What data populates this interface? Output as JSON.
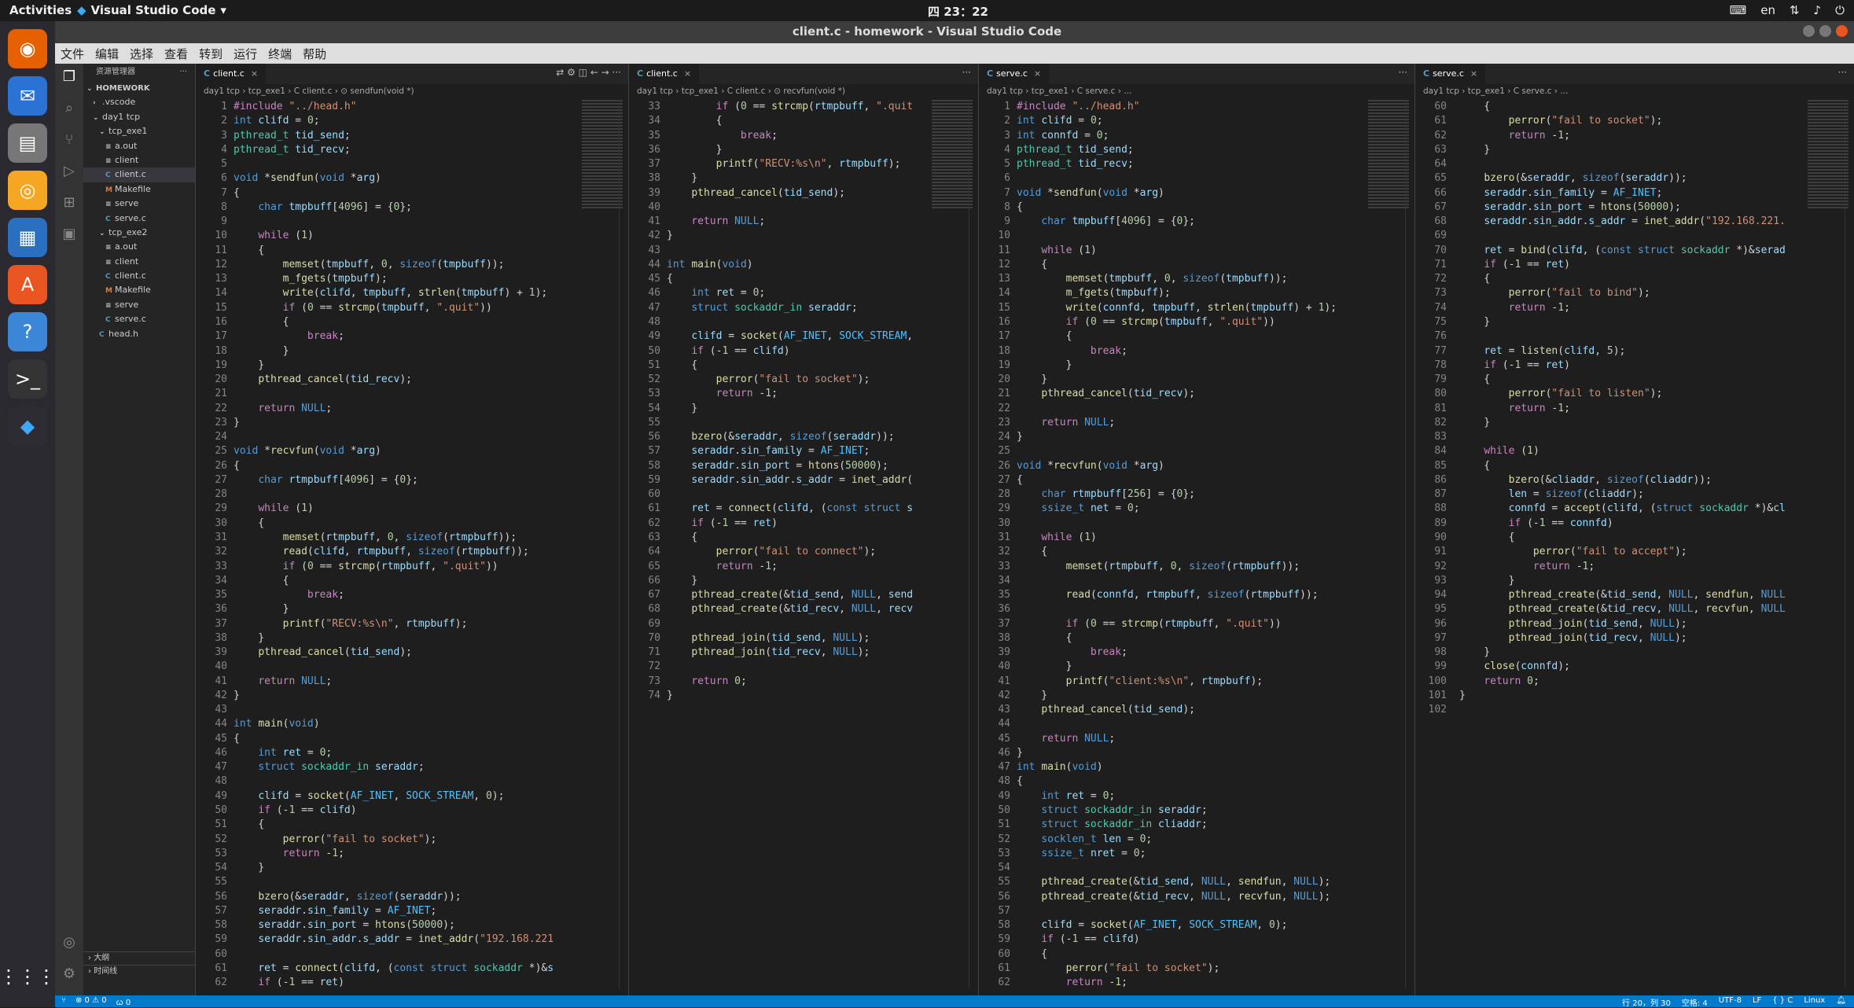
{
  "topbar": {
    "activities": "Activities",
    "app_name": "Visual Studio Code",
    "clock": "四 23：22",
    "lang": "en"
  },
  "window": {
    "title": "client.c - homework - Visual Studio Code"
  },
  "menu": [
    "文件",
    "编辑",
    "选择",
    "查看",
    "转到",
    "运行",
    "终端",
    "帮助"
  ],
  "sidebar": {
    "title": "资源管理器",
    "tree": [
      {
        "label": "HOMEWORK",
        "depth": 0,
        "icon": "chevron-down-icon"
      },
      {
        "label": ".vscode",
        "depth": 1,
        "icon": "chevron-right-icon"
      },
      {
        "label": "day1 tcp",
        "depth": 1,
        "icon": "chevron-down-icon"
      },
      {
        "label": "tcp_exe1",
        "depth": 2,
        "icon": "chevron-down-icon"
      },
      {
        "label": "a.out",
        "depth": 3,
        "icon": "binary-file-icon"
      },
      {
        "label": "client",
        "depth": 3,
        "icon": "binary-file-icon"
      },
      {
        "label": "client.c",
        "depth": 3,
        "icon": "c-file-icon",
        "selected": true
      },
      {
        "label": "Makefile",
        "depth": 3,
        "icon": "makefile-icon"
      },
      {
        "label": "serve",
        "depth": 3,
        "icon": "binary-file-icon"
      },
      {
        "label": "serve.c",
        "depth": 3,
        "icon": "c-file-icon"
      },
      {
        "label": "tcp_exe2",
        "depth": 2,
        "icon": "chevron-down-icon"
      },
      {
        "label": "a.out",
        "depth": 3,
        "icon": "binary-file-icon"
      },
      {
        "label": "client",
        "depth": 3,
        "icon": "binary-file-icon"
      },
      {
        "label": "client.c",
        "depth": 3,
        "icon": "c-file-icon"
      },
      {
        "label": "Makefile",
        "depth": 3,
        "icon": "makefile-icon"
      },
      {
        "label": "serve",
        "depth": 3,
        "icon": "binary-file-icon"
      },
      {
        "label": "serve.c",
        "depth": 3,
        "icon": "c-file-icon"
      },
      {
        "label": "head.h",
        "depth": 2,
        "icon": "c-file-icon"
      }
    ],
    "outline": "大纲",
    "timeline": "时间线"
  },
  "panes": [
    {
      "tab": "client.c",
      "breadcrumb": "day1 tcp › tcp_exe1 › C client.c › ⊙ sendfun(void *)",
      "start": 1,
      "lines": [
        "#include \"../head.h\"",
        "int clifd = 0;",
        "pthread_t tid_send;",
        "pthread_t tid_recv;",
        "",
        "void *sendfun(void *arg)",
        "{",
        "    char tmpbuff[4096] = {0};",
        "",
        "    while (1)",
        "    {",
        "        memset(tmpbuff, 0, sizeof(tmpbuff));",
        "        m_fgets(tmpbuff);",
        "        write(clifd, tmpbuff, strlen(tmpbuff) + 1);",
        "        if (0 == strcmp(tmpbuff, \".quit\"))",
        "        {",
        "            break;",
        "        }",
        "    }",
        "    pthread_cancel(tid_recv);",
        "",
        "    return NULL;",
        "}",
        "",
        "void *recvfun(void *arg)",
        "{",
        "    char rtmpbuff[4096] = {0};",
        "",
        "    while (1)",
        "    {",
        "        memset(rtmpbuff, 0, sizeof(rtmpbuff));",
        "        read(clifd, rtmpbuff, sizeof(rtmpbuff));",
        "        if (0 == strcmp(rtmpbuff, \".quit\"))",
        "        {",
        "            break;",
        "        }",
        "        printf(\"RECV:%s\\n\", rtmpbuff);",
        "    }",
        "    pthread_cancel(tid_send);",
        "",
        "    return NULL;",
        "}",
        "",
        "int main(void)",
        "{",
        "    int ret = 0;",
        "    struct sockaddr_in seraddr;",
        "",
        "    clifd = socket(AF_INET, SOCK_STREAM, 0);",
        "    if (-1 == clifd)",
        "    {",
        "        perror(\"fail to socket\");",
        "        return -1;",
        "    }",
        "",
        "    bzero(&seraddr, sizeof(seraddr));",
        "    seraddr.sin_family = AF_INET;",
        "    seraddr.sin_port = htons(50000);",
        "    seraddr.sin_addr.s_addr = inet_addr(\"192.168.221",
        "",
        "    ret = connect(clifd, (const struct sockaddr *)&s",
        "    if (-1 == ret)"
      ]
    },
    {
      "tab": "client.c",
      "breadcrumb": "day1 tcp › tcp_exe1 › C client.c › ⊙ recvfun(void *)",
      "start": 33,
      "lines": [
        "        if (0 == strcmp(rtmpbuff, \".quit",
        "        {",
        "            break;",
        "        }",
        "        printf(\"RECV:%s\\n\", rtmpbuff);",
        "    }",
        "    pthread_cancel(tid_send);",
        "",
        "    return NULL;",
        "}",
        "",
        "int main(void)",
        "{",
        "    int ret = 0;",
        "    struct sockaddr_in seraddr;",
        "",
        "    clifd = socket(AF_INET, SOCK_STREAM,",
        "    if (-1 == clifd)",
        "    {",
        "        perror(\"fail to socket\");",
        "        return -1;",
        "    }",
        "",
        "    bzero(&seraddr, sizeof(seraddr));",
        "    seraddr.sin_family = AF_INET;",
        "    seraddr.sin_port = htons(50000);",
        "    seraddr.sin_addr.s_addr = inet_addr(",
        "",
        "    ret = connect(clifd, (const struct s",
        "    if (-1 == ret)",
        "    {",
        "        perror(\"fail to connect\");",
        "        return -1;",
        "    }",
        "    pthread_create(&tid_send, NULL, send",
        "    pthread_create(&tid_recv, NULL, recv",
        "",
        "    pthread_join(tid_send, NULL);",
        "    pthread_join(tid_recv, NULL);",
        "",
        "    return 0;",
        "}"
      ]
    },
    {
      "tab": "serve.c",
      "breadcrumb": "day1 tcp › tcp_exe1 › C serve.c › ...",
      "start": 1,
      "lines": [
        "#include \"../head.h\"",
        "int clifd = 0;",
        "int connfd = 0;",
        "pthread_t tid_send;",
        "pthread_t tid_recv;",
        "",
        "void *sendfun(void *arg)",
        "{",
        "    char tmpbuff[4096] = {0};",
        "",
        "    while (1)",
        "    {",
        "        memset(tmpbuff, 0, sizeof(tmpbuff));",
        "        m_fgets(tmpbuff);",
        "        write(connfd, tmpbuff, strlen(tmpbuff) + 1);",
        "        if (0 == strcmp(tmpbuff, \".quit\"))",
        "        {",
        "            break;",
        "        }",
        "    }",
        "    pthread_cancel(tid_recv);",
        "",
        "    return NULL;",
        "}",
        "",
        "void *recvfun(void *arg)",
        "{",
        "    char rtmpbuff[256] = {0};",
        "    ssize_t net = 0;",
        "",
        "    while (1)",
        "    {",
        "        memset(rtmpbuff, 0, sizeof(rtmpbuff));",
        "",
        "        read(connfd, rtmpbuff, sizeof(rtmpbuff));",
        "",
        "        if (0 == strcmp(rtmpbuff, \".quit\"))",
        "        {",
        "            break;",
        "        }",
        "        printf(\"client:%s\\n\", rtmpbuff);",
        "    }",
        "    pthread_cancel(tid_send);",
        "",
        "    return NULL;",
        "}",
        "int main(void)",
        "{",
        "    int ret = 0;",
        "    struct sockaddr_in seraddr;",
        "    struct sockaddr_in cliaddr;",
        "    socklen_t len = 0;",
        "    ssize_t nret = 0;",
        "",
        "    pthread_create(&tid_send, NULL, sendfun, NULL);",
        "    pthread_create(&tid_recv, NULL, recvfun, NULL);",
        "",
        "    clifd = socket(AF_INET, SOCK_STREAM, 0);",
        "    if (-1 == clifd)",
        "    {",
        "        perror(\"fail to socket\");",
        "        return -1;"
      ]
    },
    {
      "tab": "serve.c",
      "breadcrumb": "day1 tcp › tcp_exe1 › C serve.c › ...",
      "start": 60,
      "lines": [
        "    {",
        "        perror(\"fail to socket\");",
        "        return -1;",
        "    }",
        "",
        "    bzero(&seraddr, sizeof(seraddr));",
        "    seraddr.sin_family = AF_INET;",
        "    seraddr.sin_port = htons(50000);",
        "    seraddr.sin_addr.s_addr = inet_addr(\"192.168.221.",
        "",
        "    ret = bind(clifd, (const struct sockaddr *)&serad",
        "    if (-1 == ret)",
        "    {",
        "        perror(\"fail to bind\");",
        "        return -1;",
        "    }",
        "",
        "    ret = listen(clifd, 5);",
        "    if (-1 == ret)",
        "    {",
        "        perror(\"fail to listen\");",
        "        return -1;",
        "    }",
        "",
        "    while (1)",
        "    {",
        "        bzero(&cliaddr, sizeof(cliaddr));",
        "        len = sizeof(cliaddr);",
        "        connfd = accept(clifd, (struct sockaddr *)&cl",
        "        if (-1 == connfd)",
        "        {",
        "            perror(\"fail to accept\");",
        "            return -1;",
        "        }",
        "        pthread_create(&tid_send, NULL, sendfun, NULL",
        "        pthread_create(&tid_recv, NULL, recvfun, NULL",
        "        pthread_join(tid_send, NULL);",
        "        pthread_join(tid_recv, NULL);",
        "    }",
        "    close(connfd);",
        "    return 0;",
        "}",
        ""
      ]
    }
  ],
  "statusbar": {
    "branch": "⑂",
    "problems": "⊗ 0 ⚠ 0",
    "ports": "ꞷ 0",
    "position": "行 20，列 30",
    "spaces": "空格: 4",
    "encoding": "UTF-8",
    "eol": "LF",
    "language": "{ } C",
    "platform": "Linux"
  },
  "dock_icons": [
    "firefox-icon",
    "thunderbird-icon",
    "files-icon",
    "rhythmbox-icon",
    "writer-icon",
    "software-icon",
    "help-icon",
    "terminal-icon",
    "vscode-icon"
  ],
  "colors": {
    "accent": "#007acc",
    "editor_bg": "#1e1e1e",
    "keyword": "#569cd6",
    "string": "#ce9178"
  }
}
